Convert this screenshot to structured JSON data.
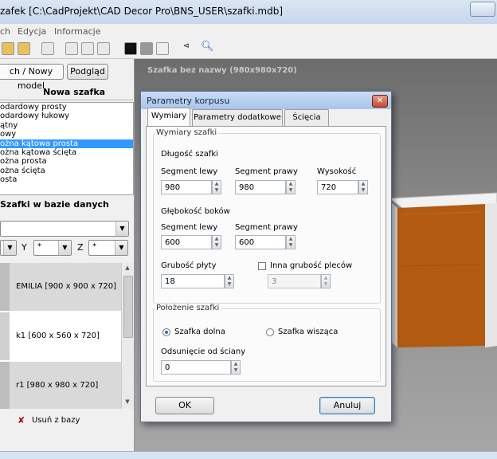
{
  "window": {
    "title": "zafek [C:\\CadProjekt\\CAD Decor Pro\\BNS_USER\\szafki.mdb]"
  },
  "menu": [
    "ch",
    "Edycja",
    "Informacje"
  ],
  "left_panel": {
    "tab_new_model": "ch / Nowy model",
    "preview_button": "Podgląd",
    "new_cabinet_heading": "Nowa szafka",
    "cabinet_types": [
      "odardowy prosty",
      "odardowy łukowy",
      "ątny",
      "owy",
      "ożna kątowa prosta",
      "ożna kątowa ścięta",
      "ożna prosta",
      "ożna ścięta",
      "osta"
    ],
    "selected_type_index": 4,
    "db_heading": "Szafki w bazie danych",
    "filter_combo_value": "",
    "axis_labels": {
      "y": "Y",
      "z": "Z"
    },
    "axis_values": {
      "x": "",
      "y": "*",
      "z": "*"
    },
    "db_items": [
      "EMILIA  [900 x 900 x 720]",
      "k1  [600 x 560 x 720]",
      "r1  [980 x 980 x 720]"
    ],
    "remove_button": "Usuń z bazy"
  },
  "canvas": {
    "title": "Szafka bez nazwy (980x980x720)"
  },
  "dialog": {
    "title": "Parametry korpusu",
    "close_glyph": "✕",
    "tabs": [
      "Wymiary",
      "Parametry dodatkowe",
      "Ścięcia"
    ],
    "active_tab": 0,
    "group_dims": "Wymiary szafki",
    "length_label": "Długość szafki",
    "seg_left_label": "Segment lewy",
    "seg_right_label": "Segment prawy",
    "height_label": "Wysokość",
    "len_left": "980",
    "len_right": "980",
    "height": "720",
    "depth_label": "Głębokość boków",
    "depth_seg_left_label": "Segment lewy",
    "depth_seg_right_label": "Segment prawy",
    "depth_left": "600",
    "depth_right": "600",
    "board_thickness_label": "Grubość płyty",
    "board_thickness": "18",
    "back_thickness_label": "Inna grubość pleców",
    "back_thickness": "3",
    "group_position": "Położenie szafki",
    "radio_floor": "Szafka dolna",
    "radio_wall": "Szafka wisząca",
    "wall_offset_label": "Odsunięcie od ściany",
    "wall_offset": "0",
    "ok_button": "OK",
    "cancel_button": "Anuluj"
  },
  "colors": {
    "selection": "#3399ff",
    "wood": "#b35a12",
    "canvas": "#8a8a8a"
  }
}
